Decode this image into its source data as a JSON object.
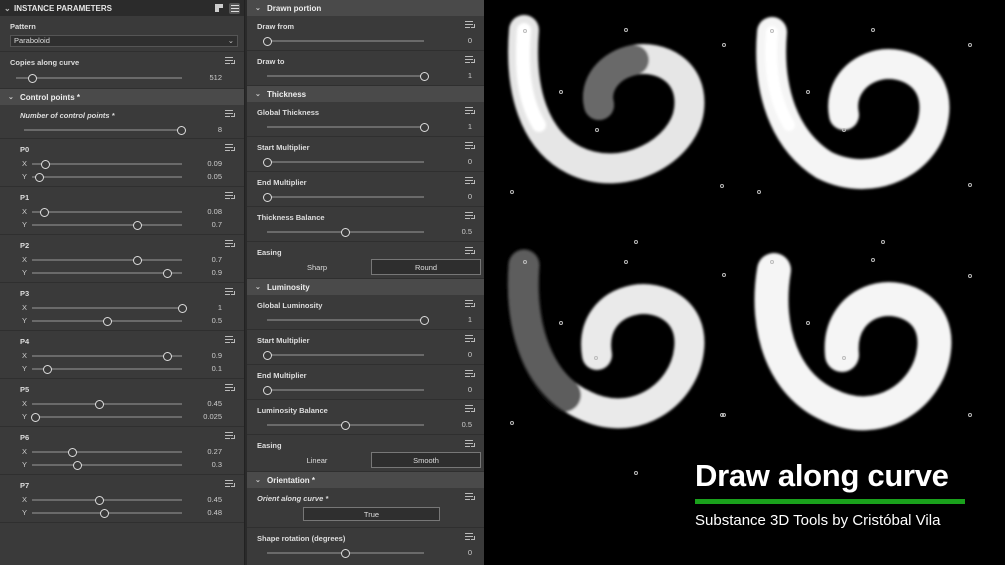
{
  "left_panel": {
    "title": "INSTANCE PARAMETERS",
    "pattern": {
      "label": "Pattern",
      "value": "Paraboloid"
    },
    "copies": {
      "label": "Copies along curve",
      "value": "512",
      "fraction": 0.1
    },
    "control_points_section": "Control points *",
    "num_control_points": {
      "label": "Number of control points *",
      "value": "8",
      "fraction": 1.0
    },
    "points": [
      {
        "label": "P0",
        "x": "0.09",
        "y": "0.05",
        "xf": 0.09,
        "yf": 0.05
      },
      {
        "label": "P1",
        "x": "0.08",
        "y": "0.7",
        "xf": 0.08,
        "yf": 0.7
      },
      {
        "label": "P2",
        "x": "0.7",
        "y": "0.9",
        "xf": 0.7,
        "yf": 0.9
      },
      {
        "label": "P3",
        "x": "1",
        "y": "0.5",
        "xf": 1.0,
        "yf": 0.5
      },
      {
        "label": "P4",
        "x": "0.9",
        "y": "0.1",
        "xf": 0.9,
        "yf": 0.1
      },
      {
        "label": "P5",
        "x": "0.45",
        "y": "0.025",
        "xf": 0.45,
        "yf": 0.025
      },
      {
        "label": "P6",
        "x": "0.27",
        "y": "0.3",
        "xf": 0.27,
        "yf": 0.3
      },
      {
        "label": "P7",
        "x": "0.45",
        "y": "0.48",
        "xf": 0.45,
        "yf": 0.48
      }
    ],
    "axis_x": "X",
    "axis_y": "Y"
  },
  "mid_panel": {
    "drawn_portion": {
      "title": "Drawn portion",
      "draw_from": {
        "label": "Draw from",
        "value": "0",
        "fraction": 0.0
      },
      "draw_to": {
        "label": "Draw to",
        "value": "1",
        "fraction": 1.0
      }
    },
    "thickness": {
      "title": "Thickness",
      "global": {
        "label": "Global Thickness",
        "value": "1",
        "fraction": 1.0
      },
      "start": {
        "label": "Start Multiplier",
        "value": "0",
        "fraction": 0.0
      },
      "end": {
        "label": "End Multiplier",
        "value": "0",
        "fraction": 0.0
      },
      "balance": {
        "label": "Thickness Balance",
        "value": "0.5",
        "fraction": 0.5
      },
      "easing": {
        "label": "Easing",
        "options": [
          "Sharp",
          "Round"
        ],
        "selected": "Round"
      }
    },
    "luminosity": {
      "title": "Luminosity",
      "global": {
        "label": "Global Luminosity",
        "value": "1",
        "fraction": 1.0
      },
      "start": {
        "label": "Start Multiplier",
        "value": "0",
        "fraction": 0.0
      },
      "end": {
        "label": "End Multiplier",
        "value": "0",
        "fraction": 0.0
      },
      "balance": {
        "label": "Luminosity Balance",
        "value": "0.5",
        "fraction": 0.5
      },
      "easing": {
        "label": "Easing",
        "options": [
          "Linear",
          "Smooth"
        ],
        "selected": "Smooth"
      }
    },
    "orientation": {
      "title": "Orientation *",
      "orient": {
        "label": "Orient along curve *",
        "value": "True"
      },
      "rotation": {
        "label": "Shape rotation (degrees)",
        "value": "0",
        "fraction": 0.5
      }
    }
  },
  "viewport": {
    "title": "Draw along curve",
    "subtitle": "Substance 3D Tools by Cristóbal Vila",
    "accent": "#1aa11c"
  }
}
